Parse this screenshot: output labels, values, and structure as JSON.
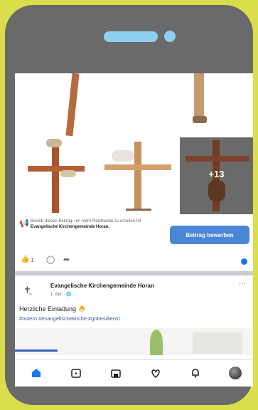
{
  "colors": {
    "background": "#d9de4a",
    "phone_frame": "#6a6a6a",
    "notch_accent": "#8fd0f0",
    "facebook_blue": "#1877f2",
    "promo_button": "#4a86d6",
    "hashtag": "#385898"
  },
  "post_photos": {
    "more_count": "+13"
  },
  "promo": {
    "icon": "megaphone-icon",
    "text": "Bewirb diesen Beitrag, um mehr Reichweite zu erzielen für",
    "page_name": "Evangelische Kirchengemeinde Horan.",
    "button_label": "Beitrag bewerben"
  },
  "reactions": {
    "like_count": "1"
  },
  "post": {
    "author": "Evangelische Kirchengemeinde Horan",
    "meta": "1. Apr. · ",
    "logo_text": "ev.",
    "text": "Herzliche Einladung 🐣",
    "hashtags": "#ostern #evangelischekirche #gottesdienst"
  },
  "tabbar": {
    "items": [
      "home-icon",
      "video-icon",
      "marketplace-icon",
      "dating-icon",
      "bell-icon",
      "profile-avatar"
    ]
  }
}
